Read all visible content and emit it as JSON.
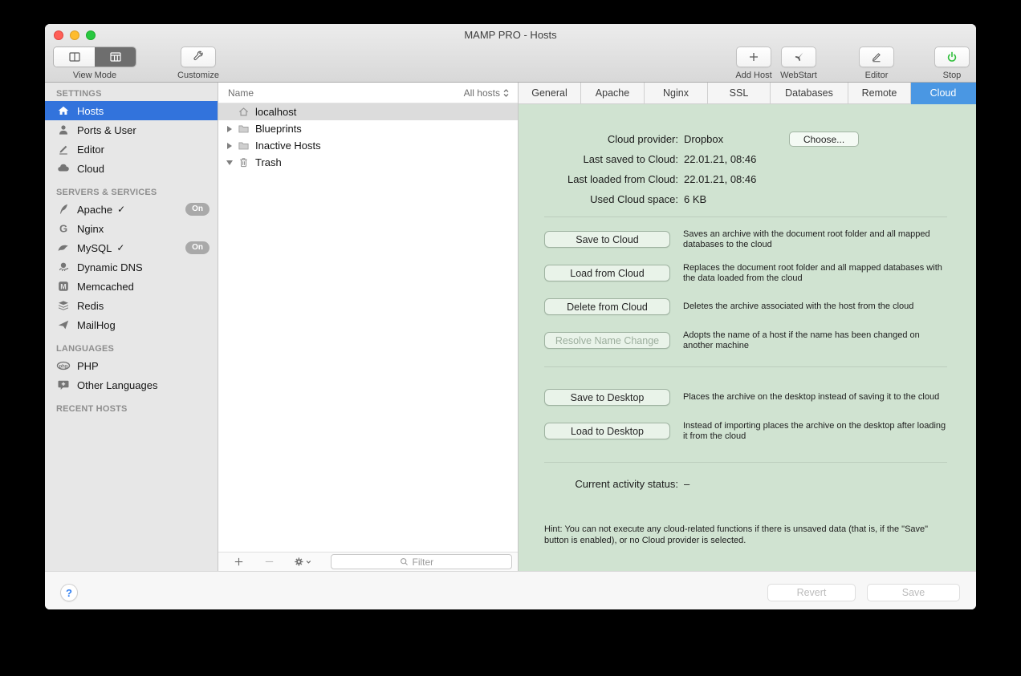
{
  "window": {
    "title": "MAMP PRO - Hosts"
  },
  "toolbar": {
    "view_mode_label": "View Mode",
    "customize_label": "Customize",
    "add_host_label": "Add Host",
    "webstart_label": "WebStart",
    "editor_label": "Editor",
    "stop_label": "Stop"
  },
  "sidebar": {
    "sections": [
      {
        "header": "SETTINGS",
        "items": [
          {
            "label": "Hosts",
            "icon": "home-icon"
          },
          {
            "label": "Ports & User",
            "icon": "user-icon"
          },
          {
            "label": "Editor",
            "icon": "pencil-icon"
          },
          {
            "label": "Cloud",
            "icon": "cloud-icon"
          }
        ]
      },
      {
        "header": "SERVERS & SERVICES",
        "items": [
          {
            "label": "Apache",
            "check": "✓",
            "badge": "On",
            "icon": "apache-feather-icon"
          },
          {
            "label": "Nginx",
            "icon": "nginx-icon"
          },
          {
            "label": "MySQL",
            "check": "✓",
            "badge": "On",
            "icon": "mysql-dolphin-icon"
          },
          {
            "label": "Dynamic DNS",
            "icon": "octopus-icon"
          },
          {
            "label": "Memcached",
            "icon": "memcached-icon"
          },
          {
            "label": "Redis",
            "icon": "redis-icon"
          },
          {
            "label": "MailHog",
            "icon": "mailhog-icon"
          }
        ]
      },
      {
        "header": "LANGUAGES",
        "items": [
          {
            "label": "PHP",
            "icon": "php-icon"
          },
          {
            "label": "Other Languages",
            "icon": "other-languages-icon"
          }
        ]
      },
      {
        "header": "RECENT HOSTS",
        "items": []
      }
    ]
  },
  "hosts_list": {
    "name_header": "Name",
    "scope_label": "All hosts",
    "rows": [
      {
        "label": "localhost",
        "icon": "home-icon",
        "selected": true
      },
      {
        "label": "Blueprints",
        "icon": "folder-icon",
        "disclosure": "collapsed"
      },
      {
        "label": "Inactive Hosts",
        "icon": "folder-icon",
        "disclosure": "collapsed"
      },
      {
        "label": "Trash",
        "icon": "trash-icon",
        "disclosure": "expanded"
      }
    ],
    "filter_placeholder": "Filter"
  },
  "tabs": {
    "items": [
      "General",
      "Apache",
      "Nginx",
      "SSL",
      "Databases",
      "Remote",
      "Cloud"
    ],
    "selected": "Cloud"
  },
  "cloud": {
    "info_rows": [
      {
        "label": "Cloud provider:",
        "value": "Dropbox"
      },
      {
        "label": "Last saved to Cloud:",
        "value": "22.01.21, 08:46"
      },
      {
        "label": "Last loaded from Cloud:",
        "value": "22.01.21, 08:46"
      },
      {
        "label": "Used Cloud space:",
        "value": "6 KB"
      }
    ],
    "choose_button": "Choose...",
    "actions": [
      {
        "button": "Save to Cloud",
        "desc": "Saves an archive with the document root folder and all mapped databases to the cloud",
        "enabled": true
      },
      {
        "button": "Load from Cloud",
        "desc": "Replaces the document root folder and all mapped databases with the data loaded from the cloud",
        "enabled": true
      },
      {
        "button": "Delete from Cloud",
        "desc": "Deletes the archive associated with the host from the cloud",
        "enabled": true
      },
      {
        "button": "Resolve Name Change",
        "desc": "Adopts the name of a host if the name has been changed on another machine",
        "enabled": false
      }
    ],
    "desktop_actions": [
      {
        "button": "Save to Desktop",
        "desc": "Places the archive on the desktop instead of saving it to the cloud"
      },
      {
        "button": "Load to Desktop",
        "desc": "Instead of importing places the archive on the desktop after loading it from the cloud"
      }
    ],
    "status_label": "Current activity status:",
    "status_value": "–",
    "hint": "Hint: You can not execute any cloud-related functions if there is unsaved data (that is, if the \"Save\" button is enabled), or no Cloud provider is selected."
  },
  "footer": {
    "help_label": "?",
    "revert_label": "Revert",
    "save_label": "Save"
  }
}
